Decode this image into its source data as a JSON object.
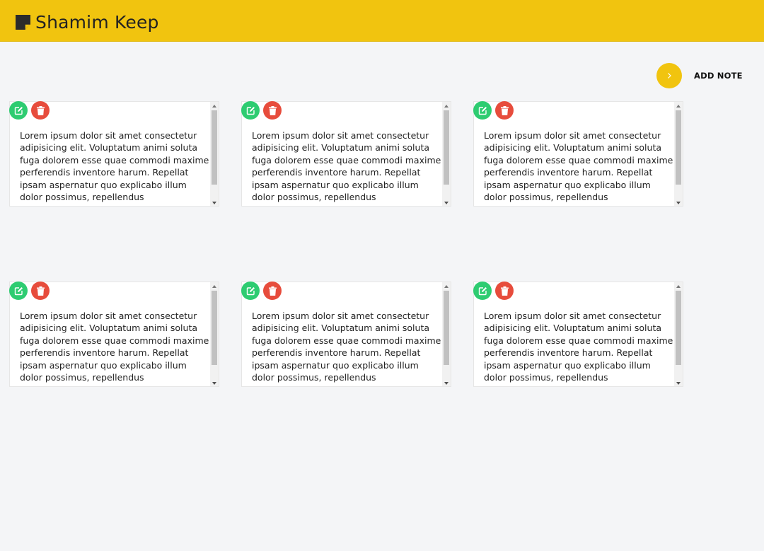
{
  "header": {
    "title": "Shamim Keep",
    "logo_icon": "sticky-note-icon",
    "background": "#f1c40f"
  },
  "actions": {
    "add_note_label": "ADD NOTE",
    "add_note_icon": "chevron-right-icon"
  },
  "notes": [
    {
      "text": "Lorem ipsum dolor sit amet consectetur adipisicing elit. Voluptatum animi soluta fuga dolorem esse quae commodi maxime perferendis inventore harum. Repellat ipsam aspernatur quo explicabo illum dolor possimus, repellendus"
    },
    {
      "text": "Lorem ipsum dolor sit amet consectetur adipisicing elit. Voluptatum animi soluta fuga dolorem esse quae commodi maxime perferendis inventore harum. Repellat ipsam aspernatur quo explicabo illum dolor possimus, repellendus"
    },
    {
      "text": "Lorem ipsum dolor sit amet consectetur adipisicing elit. Voluptatum animi soluta fuga dolorem esse quae commodi maxime perferendis inventore harum. Repellat ipsam aspernatur quo explicabo illum dolor possimus, repellendus"
    },
    {
      "text": "Lorem ipsum dolor sit amet consectetur adipisicing elit. Voluptatum animi soluta fuga dolorem esse quae commodi maxime perferendis inventore harum. Repellat ipsam aspernatur quo explicabo illum dolor possimus, repellendus"
    },
    {
      "text": "Lorem ipsum dolor sit amet consectetur adipisicing elit. Voluptatum animi soluta fuga dolorem esse quae commodi maxime perferendis inventore harum. Repellat ipsam aspernatur quo explicabo illum dolor possimus, repellendus"
    },
    {
      "text": "Lorem ipsum dolor sit amet consectetur adipisicing elit. Voluptatum animi soluta fuga dolorem esse quae commodi maxime perferendis inventore harum. Repellat ipsam aspernatur quo explicabo illum dolor possimus, repellendus"
    }
  ],
  "note_buttons": {
    "edit_icon": "edit-icon",
    "delete_icon": "trash-icon",
    "edit_color": "#2ecc71",
    "delete_color": "#e74c3c"
  }
}
